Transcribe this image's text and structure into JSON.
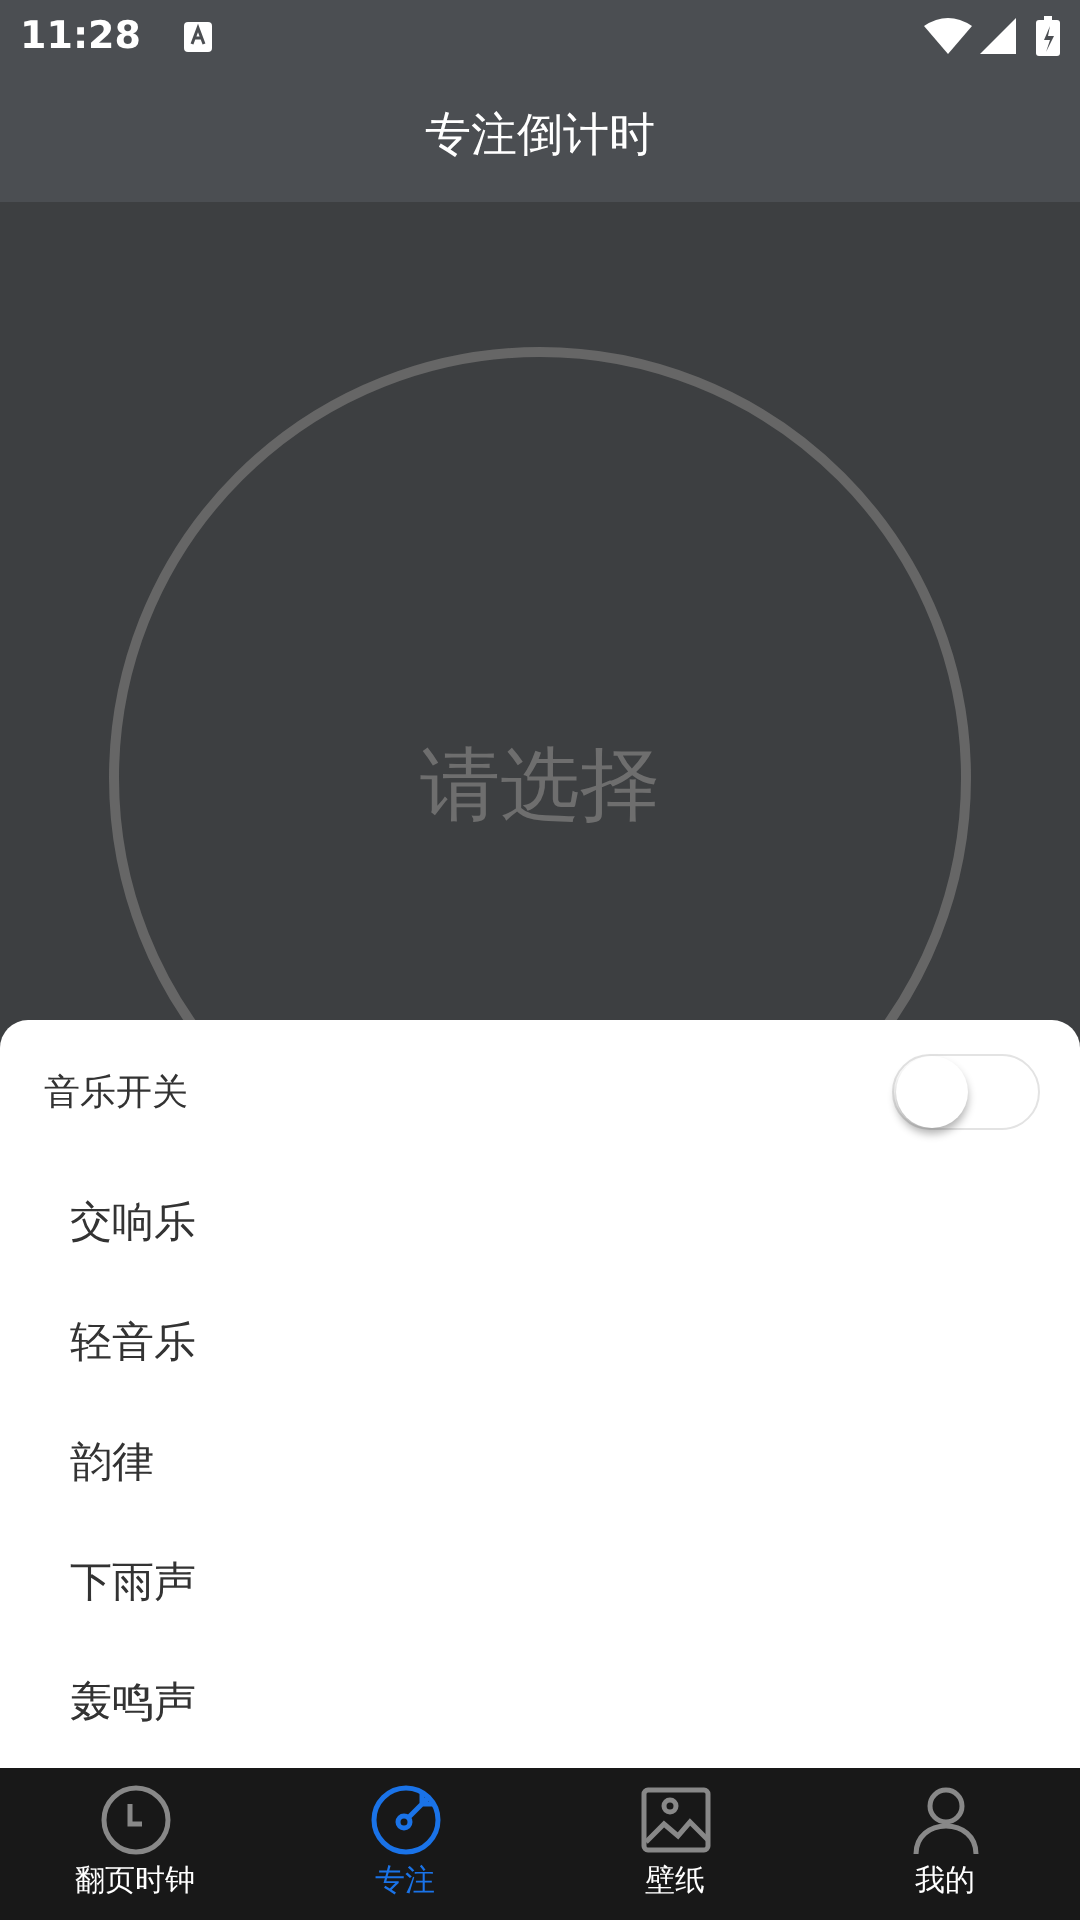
{
  "status_bar": {
    "time": "11:28"
  },
  "title": "专注倒计时",
  "timer": {
    "label": "请选择"
  },
  "music_sheet": {
    "toggle": {
      "label": "音乐开关",
      "on": false
    },
    "items": [
      {
        "label": "交响乐"
      },
      {
        "label": "轻音乐"
      },
      {
        "label": "韵律"
      },
      {
        "label": "下雨声"
      },
      {
        "label": "轰鸣声"
      }
    ]
  },
  "bottom_nav": [
    {
      "label": "翻页时钟",
      "selected": false
    },
    {
      "label": "专注",
      "selected": true
    },
    {
      "label": "壁纸",
      "selected": false
    },
    {
      "label": "我的",
      "selected": false
    }
  ]
}
